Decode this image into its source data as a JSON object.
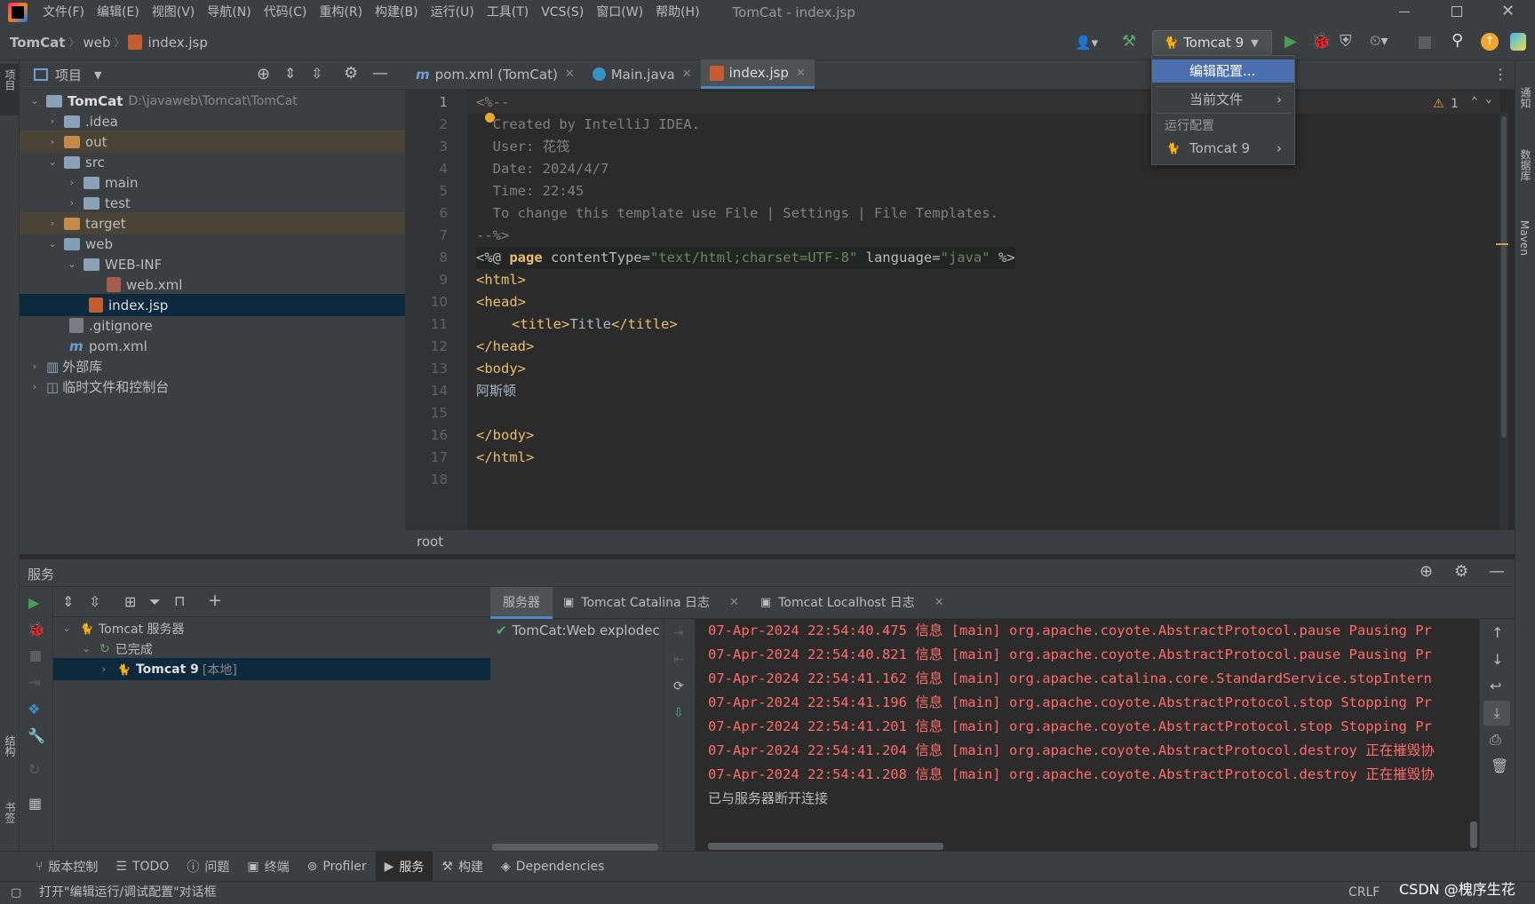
{
  "window": {
    "title": "TomCat - index.jsp"
  },
  "menu": [
    "文件(F)",
    "编辑(E)",
    "视图(V)",
    "导航(N)",
    "代码(C)",
    "重构(R)",
    "构建(B)",
    "运行(U)",
    "工具(T)",
    "VCS(S)",
    "窗口(W)",
    "帮助(H)"
  ],
  "breadcrumb": {
    "project": "TomCat",
    "folder": "web",
    "file": "index.jsp"
  },
  "run_config": {
    "label": "Tomcat 9"
  },
  "dropdown": {
    "edit_config": "编辑配置...",
    "current_file": "当前文件",
    "group_label": "运行配置",
    "tomcat_item": "Tomcat 9"
  },
  "project_panel": {
    "title": "项目",
    "tree": [
      {
        "label": "TomCat",
        "path": "D:\\javaweb\\Tomcat\\TomCat"
      },
      {
        "label": ".idea"
      },
      {
        "label": "out"
      },
      {
        "label": "src"
      },
      {
        "label": "main"
      },
      {
        "label": "test"
      },
      {
        "label": "target"
      },
      {
        "label": "web"
      },
      {
        "label": "WEB-INF"
      },
      {
        "label": "web.xml"
      },
      {
        "label": "index.jsp"
      },
      {
        "label": ".gitignore"
      },
      {
        "label": "pom.xml"
      },
      {
        "label": "外部库"
      },
      {
        "label": "临时文件和控制台"
      }
    ]
  },
  "editor_tabs": [
    "pom.xml (TomCat)",
    "Main.java",
    "index.jsp"
  ],
  "editor": {
    "line_numbers": [
      "1",
      "2",
      "3",
      "4",
      "5",
      "6",
      "7",
      "8",
      "9",
      "10",
      "11",
      "12",
      "13",
      "14",
      "15",
      "16",
      "17",
      "18"
    ],
    "lines": {
      "l1": "<%--",
      "l2": "  Created by IntelliJ IDEA.",
      "l3": "  User: 花筏",
      "l4": "  Date: 2024/4/7",
      "l5": "  Time: 22:45",
      "l6": "  To change this template use File | Settings | File Templates.",
      "l7": "--%>",
      "l8a": "<%@ ",
      "l8b": "page",
      "l8c": " contentType=",
      "l8d": "\"text/html;charset=UTF-8\"",
      "l8e": " language=",
      "l8f": "\"java\"",
      "l8g": " %>",
      "l9": "<html>",
      "l10": "<head>",
      "l11a": "<title>",
      "l11b": "Title",
      "l11c": "</title>",
      "l12": "</head>",
      "l13": "<body>",
      "l14": "阿斯顿",
      "l16": "</body>",
      "l17": "</html>"
    },
    "warning_count": "1",
    "breadcrumb_bottom": "root"
  },
  "services": {
    "title": "服务",
    "tree": {
      "server_group": "Tomcat 服务器",
      "status": "已完成",
      "server": "Tomcat 9",
      "server_tag": "[本地]"
    },
    "log_tabs": [
      "服务器",
      "Tomcat Catalina 日志",
      "Tomcat Localhost 日志"
    ],
    "deployment": "TomCat:Web explodec",
    "log_lines": [
      "07-Apr-2024 22:54:40.475 信息 [main] org.apache.coyote.AbstractProtocol.pause Pausing Pr",
      "07-Apr-2024 22:54:40.821 信息 [main] org.apache.coyote.AbstractProtocol.pause Pausing Pr",
      "07-Apr-2024 22:54:41.162 信息 [main] org.apache.catalina.core.StandardService.stopIntern",
      "07-Apr-2024 22:54:41.196 信息 [main] org.apache.coyote.AbstractProtocol.stop Stopping Pr",
      "07-Apr-2024 22:54:41.201 信息 [main] org.apache.coyote.AbstractProtocol.stop Stopping Pr",
      "07-Apr-2024 22:54:41.204 信息 [main] org.apache.coyote.AbstractProtocol.destroy 正在摧毁协",
      "07-Apr-2024 22:54:41.208 信息 [main] org.apache.coyote.AbstractProtocol.destroy 正在摧毁协"
    ],
    "disconnect": "已与服务器断开连接"
  },
  "bottom_tabs": [
    "版本控制",
    "TODO",
    "问题",
    "终端",
    "Profiler",
    "服务",
    "构建",
    "Dependencies"
  ],
  "status": {
    "message": "打开\"编辑运行/调试配置\"对话框",
    "line_sep": "CRLF",
    "watermark": "CSDN @槐序生花"
  },
  "side_tabs": {
    "left_top": "项目",
    "left_mid": "结构",
    "left_bot": "书签",
    "right_1": "通知",
    "right_2": "数据库",
    "right_3": "Maven"
  },
  "colors": {
    "accent": "#4a88c7",
    "log_error": "#ff6b68",
    "selection": "#0d293e",
    "dropdown_selected": "#4b6eaf"
  }
}
